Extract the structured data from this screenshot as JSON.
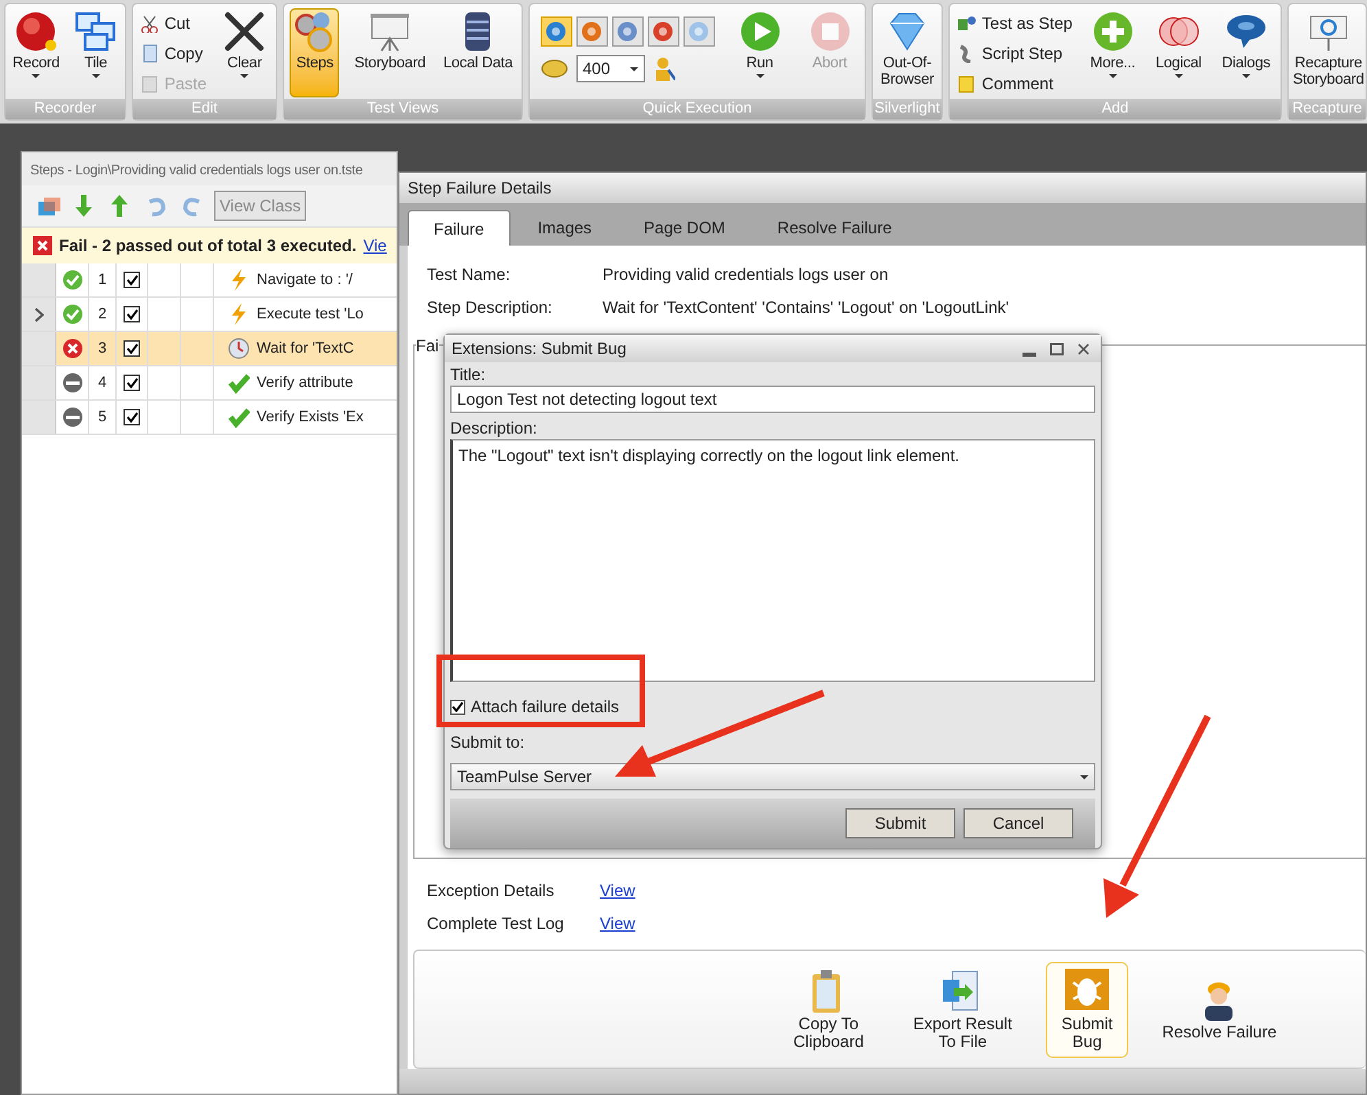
{
  "ribbon": {
    "groups": [
      {
        "label": "Recorder",
        "items": [
          {
            "kind": "large",
            "label": "Record",
            "dropdown": true,
            "selected": false,
            "disabled": false
          },
          {
            "kind": "large",
            "label": "Tile",
            "dropdown": true,
            "selected": false,
            "disabled": false
          }
        ]
      },
      {
        "label": "Edit",
        "items": [
          {
            "kind": "stack",
            "entries": [
              {
                "label": "Cut",
                "disabled": false
              },
              {
                "label": "Copy",
                "disabled": false
              },
              {
                "label": "Paste",
                "disabled": true
              }
            ]
          },
          {
            "kind": "large",
            "label": "Clear",
            "dropdown": true,
            "selected": false,
            "disabled": false
          }
        ]
      },
      {
        "label": "Test Views",
        "items": [
          {
            "kind": "large",
            "label": "Steps",
            "dropdown": false,
            "selected": true,
            "disabled": false
          },
          {
            "kind": "large",
            "label": "Storyboard",
            "dropdown": false,
            "selected": false,
            "disabled": false
          },
          {
            "kind": "large",
            "label": "Local Data",
            "dropdown": false,
            "selected": false,
            "disabled": false
          }
        ]
      },
      {
        "label": "Quick Execution",
        "items": [
          {
            "kind": "browsers",
            "browsers": [
              {
                "selected": true
              },
              {
                "selected": false
              },
              {
                "selected": false
              },
              {
                "selected": false
              },
              {
                "selected": false
              }
            ],
            "speed": "400"
          },
          {
            "kind": "large",
            "label": "Run",
            "dropdown": true,
            "selected": false,
            "disabled": false
          },
          {
            "kind": "large",
            "label": "Abort",
            "dropdown": false,
            "selected": false,
            "disabled": true
          }
        ]
      },
      {
        "label": "Silverlight",
        "items": [
          {
            "kind": "large",
            "label": "Out-Of-Browser",
            "dropdown": false,
            "selected": false,
            "disabled": false
          }
        ]
      },
      {
        "label": "Add",
        "items": [
          {
            "kind": "stack",
            "entries": [
              {
                "label": "Test as Step",
                "disabled": false
              },
              {
                "label": "Script Step",
                "disabled": false
              },
              {
                "label": "Comment",
                "disabled": false
              }
            ]
          },
          {
            "kind": "large",
            "label": "More...",
            "dropdown": true,
            "selected": false,
            "disabled": false
          },
          {
            "kind": "large",
            "label": "Logical",
            "dropdown": true,
            "selected": false,
            "disabled": false
          },
          {
            "kind": "large",
            "label": "Dialogs",
            "dropdown": true,
            "selected": false,
            "disabled": false
          }
        ]
      },
      {
        "label": "Recapture",
        "items": [
          {
            "kind": "large",
            "label": "Recapture Storyboard",
            "dropdown": false,
            "selected": false,
            "disabled": false
          }
        ]
      }
    ]
  },
  "steps_panel": {
    "title": "Steps - Login\\Providing valid credentials logs user on.tste",
    "view_class_button": "View Class",
    "result": {
      "text": "Fail - 2 passed out of total 3 executed.",
      "link": "Vie"
    },
    "rows": [
      {
        "number": "1",
        "passed": true,
        "failed": false,
        "checked": true,
        "current": false,
        "selected": false,
        "kind": "action",
        "description": "Navigate to : '/"
      },
      {
        "number": "2",
        "passed": true,
        "failed": false,
        "checked": true,
        "current": true,
        "selected": false,
        "kind": "action",
        "description": "Execute test 'Lo"
      },
      {
        "number": "3",
        "passed": false,
        "failed": true,
        "checked": true,
        "current": false,
        "selected": true,
        "kind": "wait",
        "description": "Wait for 'TextC"
      },
      {
        "number": "4",
        "passed": false,
        "failed": false,
        "checked": true,
        "current": false,
        "selected": false,
        "kind": "verify",
        "description": "Verify attribute"
      },
      {
        "number": "5",
        "passed": false,
        "failed": false,
        "checked": true,
        "current": false,
        "selected": false,
        "kind": "verify",
        "description": "Verify Exists 'Ex"
      }
    ]
  },
  "failure_window": {
    "title": "Step Failure Details",
    "tabs": [
      {
        "label": "Failure",
        "selected": true
      },
      {
        "label": "Images",
        "selected": false
      },
      {
        "label": "Page DOM",
        "selected": false
      },
      {
        "label": "Resolve Failure",
        "selected": false
      }
    ],
    "details": [
      {
        "label": "Test Name:",
        "value": "Providing valid credentials logs user on"
      },
      {
        "label": "Step Description:",
        "value": "Wait for 'TextContent' 'Contains' 'Logout' on 'LogoutLink'"
      }
    ],
    "group_label": "Fai",
    "links": [
      {
        "label": "Exception Details",
        "link": "View"
      },
      {
        "label": "Complete Test Log",
        "link": "View"
      }
    ],
    "actions": [
      {
        "lines": [
          "Copy To",
          "Clipboard"
        ],
        "selected": false
      },
      {
        "lines": [
          "Export Result",
          "To File"
        ],
        "selected": false
      },
      {
        "lines": [
          "Submit",
          "Bug"
        ],
        "selected": true
      },
      {
        "lines": [
          "Resolve Failure"
        ],
        "selected": false
      }
    ]
  },
  "submit_bug_dialog": {
    "title": "Extensions: Submit Bug",
    "title_label": "Title:",
    "title_value": "Logon Test not detecting logout text",
    "description_label": "Description:",
    "description_value": "The \"Logout\" text isn't displaying correctly on the logout link element.",
    "attach": {
      "label": "Attach failure details",
      "checked": true
    },
    "submit_to_label": "Submit to:",
    "submit_to_value": "TeamPulse Server",
    "buttons": [
      "Submit",
      "Cancel"
    ]
  }
}
